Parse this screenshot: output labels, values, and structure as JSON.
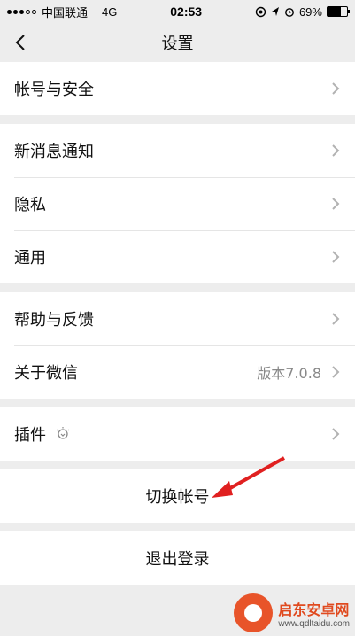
{
  "status": {
    "carrier": "中国联通",
    "network": "4G",
    "time": "02:53",
    "battery": "69%",
    "battery_level": 0.69
  },
  "nav": {
    "title": "设置"
  },
  "groups": {
    "account": {
      "label": "帐号与安全"
    },
    "notify": {
      "label": "新消息通知"
    },
    "privacy": {
      "label": "隐私"
    },
    "general": {
      "label": "通用"
    },
    "help": {
      "label": "帮助与反馈"
    },
    "about": {
      "label": "关于微信",
      "value": "版本7.0.8"
    },
    "plugins": {
      "label": "插件"
    },
    "switch_account": {
      "label": "切换帐号"
    },
    "logout": {
      "label": "退出登录"
    }
  },
  "watermark": {
    "title": "启东安卓网",
    "url": "www.qdltaidu.com"
  },
  "colors": {
    "background": "#ededed",
    "arrow": "#e02020"
  }
}
